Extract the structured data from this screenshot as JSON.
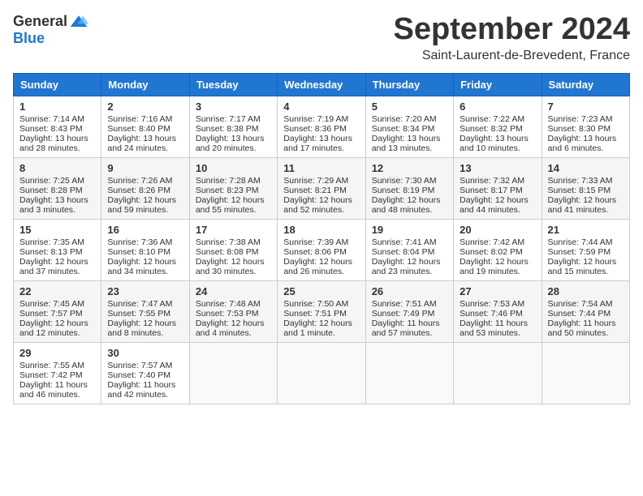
{
  "header": {
    "logo_general": "General",
    "logo_blue": "Blue",
    "month_title": "September 2024",
    "location": "Saint-Laurent-de-Brevedent, France"
  },
  "weekdays": [
    "Sunday",
    "Monday",
    "Tuesday",
    "Wednesday",
    "Thursday",
    "Friday",
    "Saturday"
  ],
  "weeks": [
    [
      {
        "day": "1",
        "sunrise": "7:14 AM",
        "sunset": "8:43 PM",
        "daylight": "13 hours and 28 minutes."
      },
      {
        "day": "2",
        "sunrise": "7:16 AM",
        "sunset": "8:40 PM",
        "daylight": "13 hours and 24 minutes."
      },
      {
        "day": "3",
        "sunrise": "7:17 AM",
        "sunset": "8:38 PM",
        "daylight": "13 hours and 20 minutes."
      },
      {
        "day": "4",
        "sunrise": "7:19 AM",
        "sunset": "8:36 PM",
        "daylight": "13 hours and 17 minutes."
      },
      {
        "day": "5",
        "sunrise": "7:20 AM",
        "sunset": "8:34 PM",
        "daylight": "13 hours and 13 minutes."
      },
      {
        "day": "6",
        "sunrise": "7:22 AM",
        "sunset": "8:32 PM",
        "daylight": "13 hours and 10 minutes."
      },
      {
        "day": "7",
        "sunrise": "7:23 AM",
        "sunset": "8:30 PM",
        "daylight": "13 hours and 6 minutes."
      }
    ],
    [
      {
        "day": "8",
        "sunrise": "7:25 AM",
        "sunset": "8:28 PM",
        "daylight": "13 hours and 3 minutes."
      },
      {
        "day": "9",
        "sunrise": "7:26 AM",
        "sunset": "8:26 PM",
        "daylight": "12 hours and 59 minutes."
      },
      {
        "day": "10",
        "sunrise": "7:28 AM",
        "sunset": "8:23 PM",
        "daylight": "12 hours and 55 minutes."
      },
      {
        "day": "11",
        "sunrise": "7:29 AM",
        "sunset": "8:21 PM",
        "daylight": "12 hours and 52 minutes."
      },
      {
        "day": "12",
        "sunrise": "7:30 AM",
        "sunset": "8:19 PM",
        "daylight": "12 hours and 48 minutes."
      },
      {
        "day": "13",
        "sunrise": "7:32 AM",
        "sunset": "8:17 PM",
        "daylight": "12 hours and 44 minutes."
      },
      {
        "day": "14",
        "sunrise": "7:33 AM",
        "sunset": "8:15 PM",
        "daylight": "12 hours and 41 minutes."
      }
    ],
    [
      {
        "day": "15",
        "sunrise": "7:35 AM",
        "sunset": "8:13 PM",
        "daylight": "12 hours and 37 minutes."
      },
      {
        "day": "16",
        "sunrise": "7:36 AM",
        "sunset": "8:10 PM",
        "daylight": "12 hours and 34 minutes."
      },
      {
        "day": "17",
        "sunrise": "7:38 AM",
        "sunset": "8:08 PM",
        "daylight": "12 hours and 30 minutes."
      },
      {
        "day": "18",
        "sunrise": "7:39 AM",
        "sunset": "8:06 PM",
        "daylight": "12 hours and 26 minutes."
      },
      {
        "day": "19",
        "sunrise": "7:41 AM",
        "sunset": "8:04 PM",
        "daylight": "12 hours and 23 minutes."
      },
      {
        "day": "20",
        "sunrise": "7:42 AM",
        "sunset": "8:02 PM",
        "daylight": "12 hours and 19 minutes."
      },
      {
        "day": "21",
        "sunrise": "7:44 AM",
        "sunset": "7:59 PM",
        "daylight": "12 hours and 15 minutes."
      }
    ],
    [
      {
        "day": "22",
        "sunrise": "7:45 AM",
        "sunset": "7:57 PM",
        "daylight": "12 hours and 12 minutes."
      },
      {
        "day": "23",
        "sunrise": "7:47 AM",
        "sunset": "7:55 PM",
        "daylight": "12 hours and 8 minutes."
      },
      {
        "day": "24",
        "sunrise": "7:48 AM",
        "sunset": "7:53 PM",
        "daylight": "12 hours and 4 minutes."
      },
      {
        "day": "25",
        "sunrise": "7:50 AM",
        "sunset": "7:51 PM",
        "daylight": "12 hours and 1 minute."
      },
      {
        "day": "26",
        "sunrise": "7:51 AM",
        "sunset": "7:49 PM",
        "daylight": "11 hours and 57 minutes."
      },
      {
        "day": "27",
        "sunrise": "7:53 AM",
        "sunset": "7:46 PM",
        "daylight": "11 hours and 53 minutes."
      },
      {
        "day": "28",
        "sunrise": "7:54 AM",
        "sunset": "7:44 PM",
        "daylight": "11 hours and 50 minutes."
      }
    ],
    [
      {
        "day": "29",
        "sunrise": "7:55 AM",
        "sunset": "7:42 PM",
        "daylight": "11 hours and 46 minutes."
      },
      {
        "day": "30",
        "sunrise": "7:57 AM",
        "sunset": "7:40 PM",
        "daylight": "11 hours and 42 minutes."
      },
      null,
      null,
      null,
      null,
      null
    ]
  ]
}
